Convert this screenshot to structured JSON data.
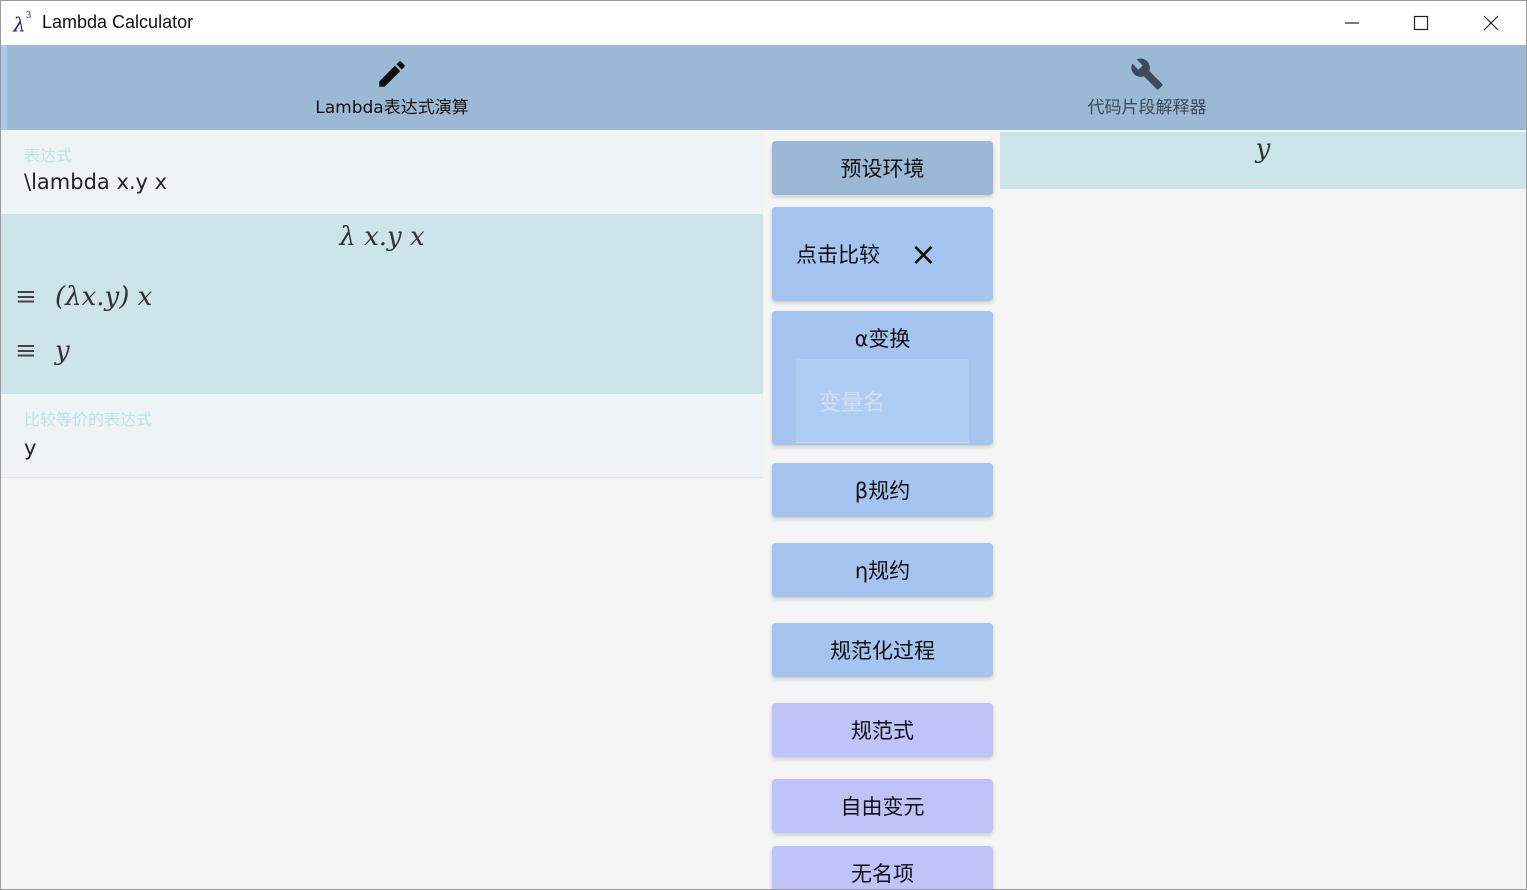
{
  "window": {
    "title": "Lambda Calculator",
    "icon_label": "λ",
    "icon_sup": "3"
  },
  "nav": {
    "tabs": [
      {
        "label": "Lambda表达式演算",
        "icon": "pencil-icon"
      },
      {
        "label": "代码片段解释器",
        "icon": "wrench-icon"
      }
    ]
  },
  "expression": {
    "label": "表达式",
    "value": "\\lambda x.y x",
    "rendered": "λ x.y x",
    "steps": [
      {
        "symbol": "≡",
        "expr": "(λx.y) x"
      },
      {
        "symbol": "≡",
        "expr": "y"
      }
    ]
  },
  "compare": {
    "label": "比较等价的表达式",
    "value": "y"
  },
  "buttons": {
    "preset": "预设环境",
    "compare": "点击比较",
    "compare_icon": "×",
    "alpha": "α变换",
    "alpha_placeholder": "变量名",
    "beta": "β规约",
    "eta": "η规约",
    "normalize_process": "规范化过程",
    "normal_form": "规范式",
    "free_vars": "自由变元",
    "anonymous": "无名项"
  },
  "right": {
    "result": "y"
  },
  "colors": {
    "nav_bg": "#9bb8d5",
    "button_blue": "#a6c4f0",
    "button_purple": "#c0c3f9",
    "render_bg": "#cde4ea",
    "field_bg": "#eef3f6"
  }
}
